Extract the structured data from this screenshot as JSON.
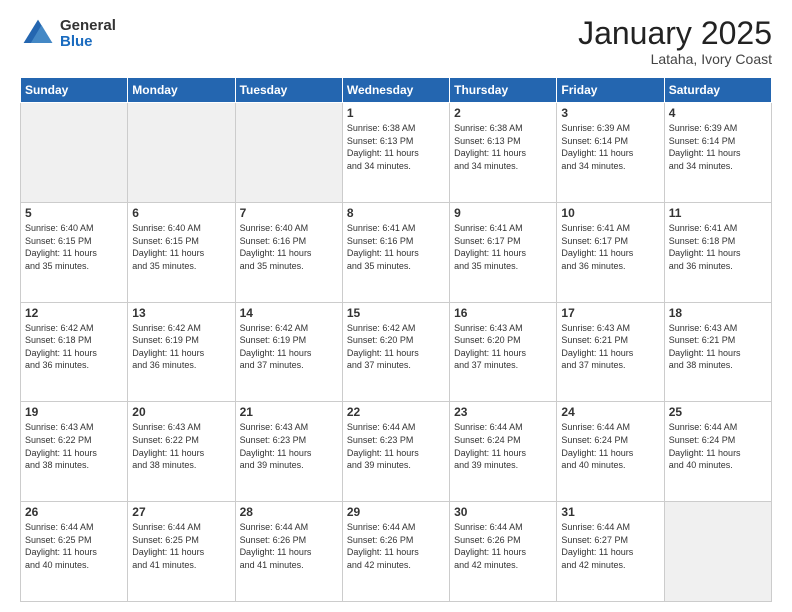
{
  "header": {
    "logo_general": "General",
    "logo_blue": "Blue",
    "month_title": "January 2025",
    "subtitle": "Lataha, Ivory Coast"
  },
  "weekdays": [
    "Sunday",
    "Monday",
    "Tuesday",
    "Wednesday",
    "Thursday",
    "Friday",
    "Saturday"
  ],
  "weeks": [
    [
      {
        "day": "",
        "info": ""
      },
      {
        "day": "",
        "info": ""
      },
      {
        "day": "",
        "info": ""
      },
      {
        "day": "1",
        "info": "Sunrise: 6:38 AM\nSunset: 6:13 PM\nDaylight: 11 hours\nand 34 minutes."
      },
      {
        "day": "2",
        "info": "Sunrise: 6:38 AM\nSunset: 6:13 PM\nDaylight: 11 hours\nand 34 minutes."
      },
      {
        "day": "3",
        "info": "Sunrise: 6:39 AM\nSunset: 6:14 PM\nDaylight: 11 hours\nand 34 minutes."
      },
      {
        "day": "4",
        "info": "Sunrise: 6:39 AM\nSunset: 6:14 PM\nDaylight: 11 hours\nand 34 minutes."
      }
    ],
    [
      {
        "day": "5",
        "info": "Sunrise: 6:40 AM\nSunset: 6:15 PM\nDaylight: 11 hours\nand 35 minutes."
      },
      {
        "day": "6",
        "info": "Sunrise: 6:40 AM\nSunset: 6:15 PM\nDaylight: 11 hours\nand 35 minutes."
      },
      {
        "day": "7",
        "info": "Sunrise: 6:40 AM\nSunset: 6:16 PM\nDaylight: 11 hours\nand 35 minutes."
      },
      {
        "day": "8",
        "info": "Sunrise: 6:41 AM\nSunset: 6:16 PM\nDaylight: 11 hours\nand 35 minutes."
      },
      {
        "day": "9",
        "info": "Sunrise: 6:41 AM\nSunset: 6:17 PM\nDaylight: 11 hours\nand 35 minutes."
      },
      {
        "day": "10",
        "info": "Sunrise: 6:41 AM\nSunset: 6:17 PM\nDaylight: 11 hours\nand 36 minutes."
      },
      {
        "day": "11",
        "info": "Sunrise: 6:41 AM\nSunset: 6:18 PM\nDaylight: 11 hours\nand 36 minutes."
      }
    ],
    [
      {
        "day": "12",
        "info": "Sunrise: 6:42 AM\nSunset: 6:18 PM\nDaylight: 11 hours\nand 36 minutes."
      },
      {
        "day": "13",
        "info": "Sunrise: 6:42 AM\nSunset: 6:19 PM\nDaylight: 11 hours\nand 36 minutes."
      },
      {
        "day": "14",
        "info": "Sunrise: 6:42 AM\nSunset: 6:19 PM\nDaylight: 11 hours\nand 37 minutes."
      },
      {
        "day": "15",
        "info": "Sunrise: 6:42 AM\nSunset: 6:20 PM\nDaylight: 11 hours\nand 37 minutes."
      },
      {
        "day": "16",
        "info": "Sunrise: 6:43 AM\nSunset: 6:20 PM\nDaylight: 11 hours\nand 37 minutes."
      },
      {
        "day": "17",
        "info": "Sunrise: 6:43 AM\nSunset: 6:21 PM\nDaylight: 11 hours\nand 37 minutes."
      },
      {
        "day": "18",
        "info": "Sunrise: 6:43 AM\nSunset: 6:21 PM\nDaylight: 11 hours\nand 38 minutes."
      }
    ],
    [
      {
        "day": "19",
        "info": "Sunrise: 6:43 AM\nSunset: 6:22 PM\nDaylight: 11 hours\nand 38 minutes."
      },
      {
        "day": "20",
        "info": "Sunrise: 6:43 AM\nSunset: 6:22 PM\nDaylight: 11 hours\nand 38 minutes."
      },
      {
        "day": "21",
        "info": "Sunrise: 6:43 AM\nSunset: 6:23 PM\nDaylight: 11 hours\nand 39 minutes."
      },
      {
        "day": "22",
        "info": "Sunrise: 6:44 AM\nSunset: 6:23 PM\nDaylight: 11 hours\nand 39 minutes."
      },
      {
        "day": "23",
        "info": "Sunrise: 6:44 AM\nSunset: 6:24 PM\nDaylight: 11 hours\nand 39 minutes."
      },
      {
        "day": "24",
        "info": "Sunrise: 6:44 AM\nSunset: 6:24 PM\nDaylight: 11 hours\nand 40 minutes."
      },
      {
        "day": "25",
        "info": "Sunrise: 6:44 AM\nSunset: 6:24 PM\nDaylight: 11 hours\nand 40 minutes."
      }
    ],
    [
      {
        "day": "26",
        "info": "Sunrise: 6:44 AM\nSunset: 6:25 PM\nDaylight: 11 hours\nand 40 minutes."
      },
      {
        "day": "27",
        "info": "Sunrise: 6:44 AM\nSunset: 6:25 PM\nDaylight: 11 hours\nand 41 minutes."
      },
      {
        "day": "28",
        "info": "Sunrise: 6:44 AM\nSunset: 6:26 PM\nDaylight: 11 hours\nand 41 minutes."
      },
      {
        "day": "29",
        "info": "Sunrise: 6:44 AM\nSunset: 6:26 PM\nDaylight: 11 hours\nand 42 minutes."
      },
      {
        "day": "30",
        "info": "Sunrise: 6:44 AM\nSunset: 6:26 PM\nDaylight: 11 hours\nand 42 minutes."
      },
      {
        "day": "31",
        "info": "Sunrise: 6:44 AM\nSunset: 6:27 PM\nDaylight: 11 hours\nand 42 minutes."
      },
      {
        "day": "",
        "info": ""
      }
    ]
  ]
}
